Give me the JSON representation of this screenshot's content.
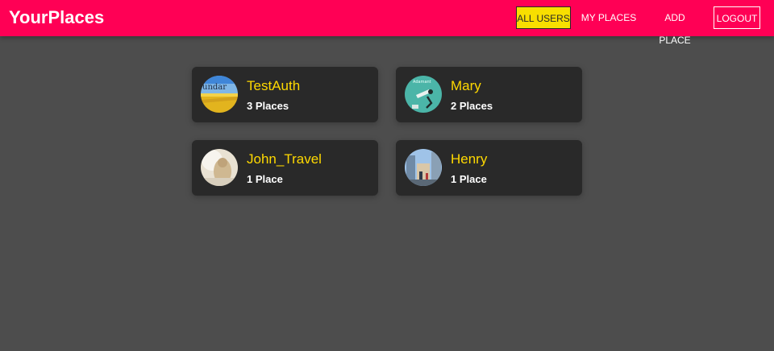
{
  "header": {
    "logo": "YourPlaces",
    "nav": [
      {
        "label": "ALL USERS",
        "active": true
      },
      {
        "label": "MY PLACES",
        "active": false
      },
      {
        "label": "ADD PLACE",
        "active": false
      },
      {
        "label": "LOGOUT",
        "active": false
      }
    ]
  },
  "users": [
    {
      "name": "TestAuth",
      "places": "3 Places",
      "avatar": "wheat-field-image"
    },
    {
      "name": "Mary",
      "places": "2 Places",
      "avatar": "adamant-illustration-image"
    },
    {
      "name": "John_Travel",
      "places": "1 Place",
      "avatar": "blurred-person-image"
    },
    {
      "name": "Henry",
      "places": "1 Place",
      "avatar": "city-street-image"
    }
  ],
  "colors": {
    "header_bg": "#ff0055",
    "page_bg": "#4d4d4d",
    "card_bg": "#292929",
    "accent_yellow": "#ffd900",
    "active_nav_bg": "#f8df00"
  }
}
